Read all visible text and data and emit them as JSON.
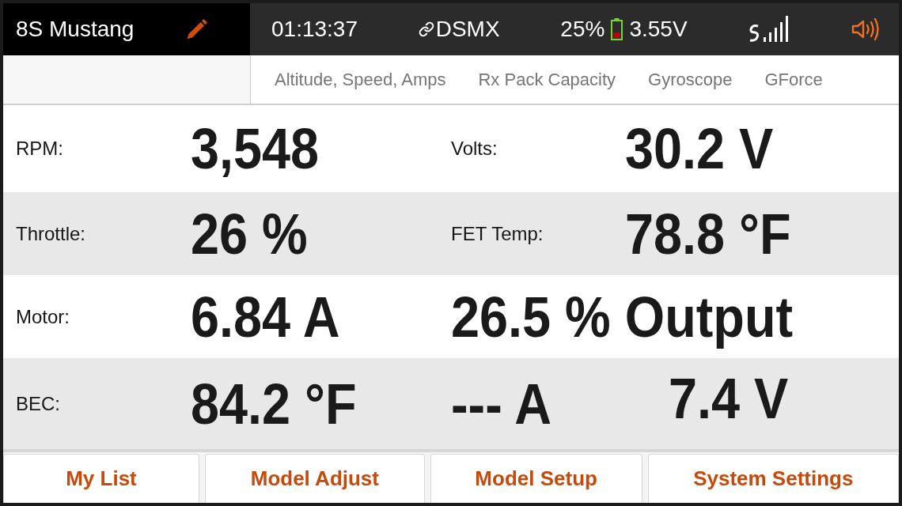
{
  "status_bar": {
    "model_name": "8S Mustang",
    "timer": "01:13:37",
    "protocol": "DSMX",
    "battery_percent": "25%",
    "battery_voltage": "3.55V"
  },
  "telemetry_tabs": [
    "Altitude, Speed, Amps",
    "Rx Pack Capacity",
    "Gyroscope",
    "GForce"
  ],
  "rows": [
    {
      "cells": [
        {
          "kind": "label",
          "text": "RPM:"
        },
        {
          "kind": "value",
          "text": "3,548"
        },
        {
          "kind": "label",
          "text": "Volts:"
        },
        {
          "kind": "value",
          "text": "30.2 V"
        }
      ]
    },
    {
      "cells": [
        {
          "kind": "label",
          "text": "Throttle:"
        },
        {
          "kind": "value",
          "text": "26 %"
        },
        {
          "kind": "label",
          "text": "FET Temp:"
        },
        {
          "kind": "value",
          "text": "78.8 °F"
        }
      ]
    },
    {
      "cells": [
        {
          "kind": "label",
          "text": "Motor:"
        },
        {
          "kind": "value",
          "text": "6.84 A"
        },
        {
          "kind": "wide",
          "text": "26.5 % Output"
        }
      ]
    },
    {
      "cells": [
        {
          "kind": "label",
          "text": "BEC:"
        },
        {
          "kind": "value",
          "text": "84.2 °F"
        },
        {
          "kind": "value",
          "text": "--- A"
        },
        {
          "kind": "offset",
          "text": "7.4 V"
        }
      ]
    }
  ],
  "footer_buttons": [
    "My List",
    "Model Adjust",
    "Model Setup",
    "System Settings"
  ]
}
